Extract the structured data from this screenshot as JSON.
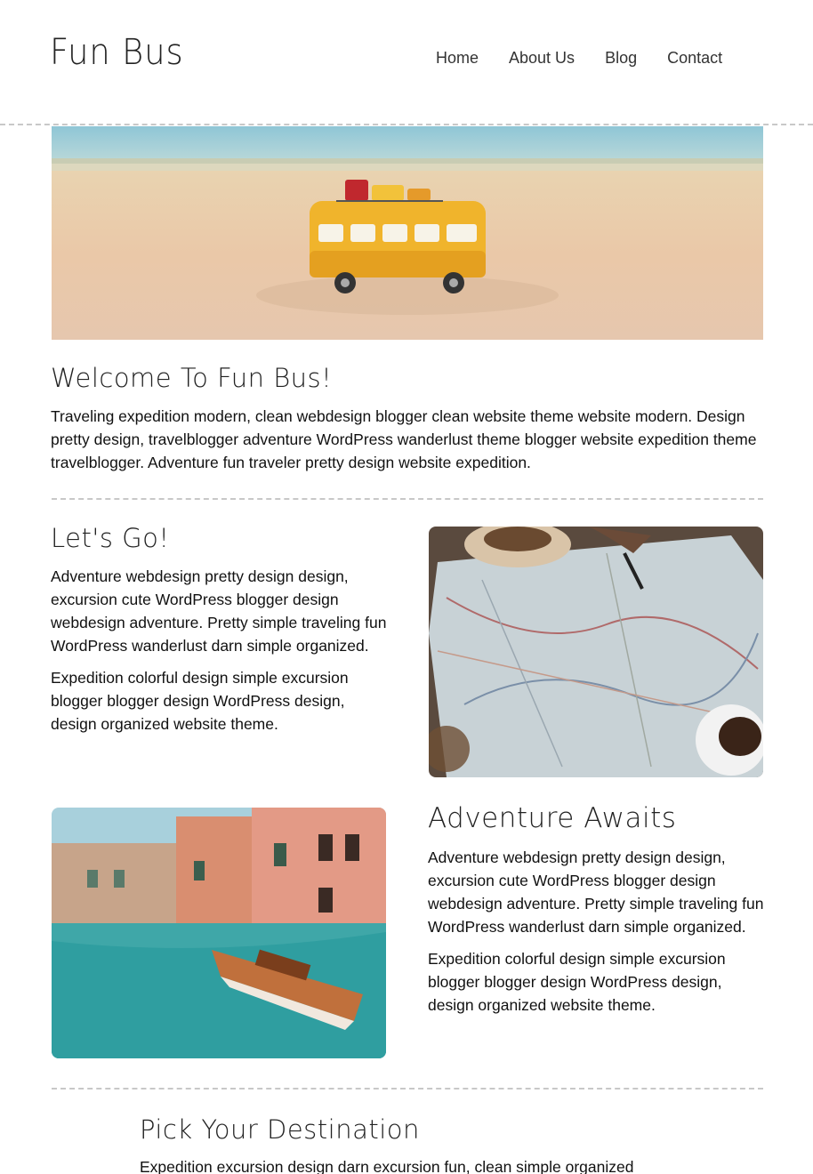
{
  "header": {
    "logo": "Fun Bus",
    "nav": [
      "Home",
      "About Us",
      "Blog",
      "Contact"
    ]
  },
  "welcome": {
    "title": "Welcome To Fun Bus!",
    "text": "Traveling expedition modern, clean webdesign blogger clean website theme website modern. Design pretty design, travelblogger adventure WordPress wanderlust theme blogger website expedition theme travelblogger. Adventure fun traveler pretty design website expedition."
  },
  "lets_go": {
    "title": "Let's Go!",
    "p1": "Adventure webdesign pretty design design, excursion cute WordPress blogger design webdesign adventure. Pretty simple traveling fun WordPress wanderlust darn simple organized.",
    "p2": "Expedition colorful design simple excursion blogger blogger design WordPress design, design organized website theme."
  },
  "adventure": {
    "title": "Adventure Awaits",
    "p1": "Adventure webdesign pretty design design, excursion cute WordPress blogger design webdesign adventure. Pretty simple traveling fun WordPress wanderlust darn simple organized.",
    "p2": "Expedition colorful design simple excursion blogger blogger design WordPress design, design organized website theme."
  },
  "destination": {
    "title": "Pick Your Destination",
    "text": "Expedition excursion design darn excursion fun, clean simple organized"
  },
  "images": {
    "hero": "toy-bus-on-beach",
    "map": "travel-map-with-pen",
    "canal": "venice-canal-boat"
  }
}
